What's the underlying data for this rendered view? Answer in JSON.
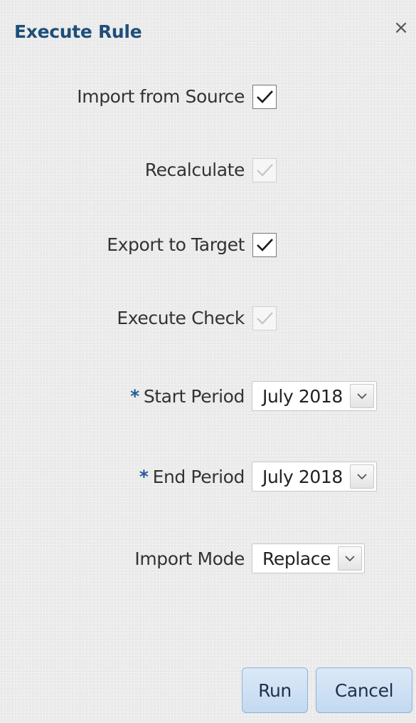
{
  "dialog": {
    "title": "Execute Rule",
    "close_glyph": "×"
  },
  "options": [
    {
      "label": "Import from Source",
      "checked": true,
      "enabled": true
    },
    {
      "label": "Recalculate",
      "checked": true,
      "enabled": false
    },
    {
      "label": "Export to Target",
      "checked": true,
      "enabled": true
    },
    {
      "label": "Execute Check",
      "checked": true,
      "enabled": false
    }
  ],
  "start_period": {
    "required_marker": "*",
    "label": "Start Period",
    "value": "July 2018"
  },
  "end_period": {
    "required_marker": "*",
    "label": "End Period",
    "value": "July 2018"
  },
  "import_mode": {
    "label": "Import Mode",
    "value": "Replace"
  },
  "buttons": {
    "run": "Run",
    "cancel": "Cancel"
  },
  "colors": {
    "title": "#1f4e79",
    "required_marker": "#1f5b96",
    "button_fill": "#c9ddf2",
    "button_border": "#8fb2d6",
    "background": "#ececec"
  }
}
